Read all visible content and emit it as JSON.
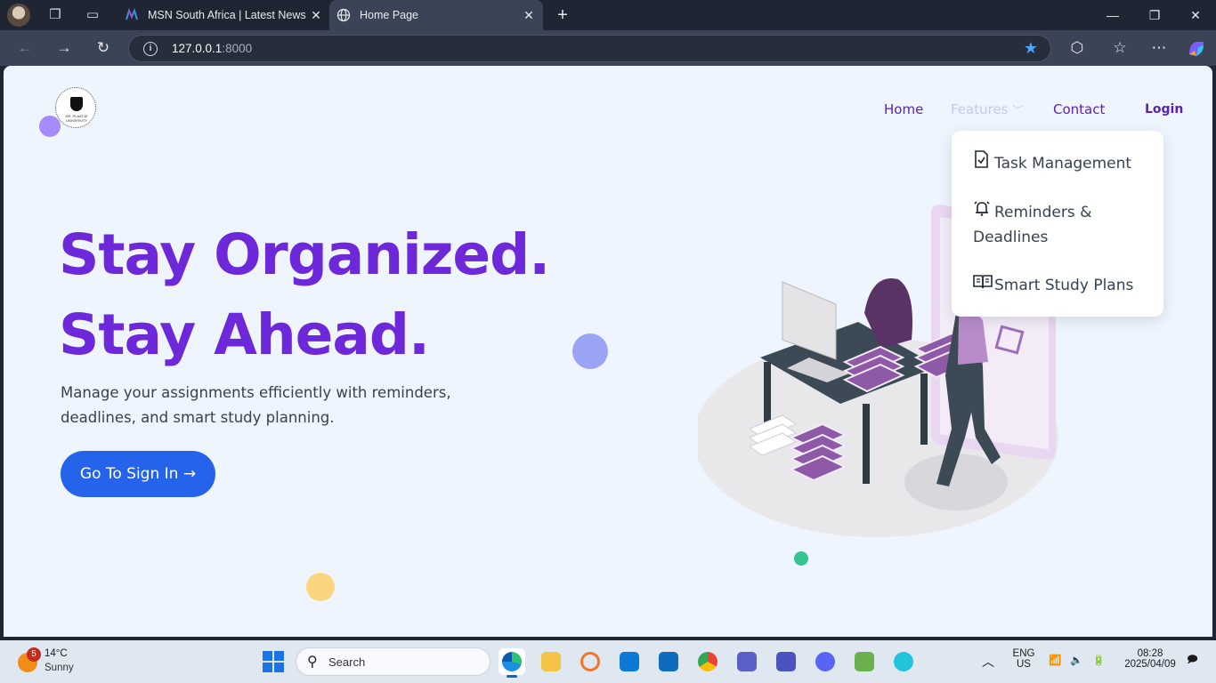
{
  "browser": {
    "tabs": [
      {
        "title": "MSN South Africa | Latest News, F",
        "icon": "msn-icon",
        "active": false
      },
      {
        "title": "Home Page",
        "icon": "globe-icon",
        "active": true
      }
    ],
    "url_host": "127.0.0.1",
    "url_port": ":8000"
  },
  "site": {
    "logo_caption": "DR. PLAATJE UNIVERSITY",
    "nav": {
      "home": "Home",
      "features": "Features",
      "contact": "Contact",
      "login": "Login"
    },
    "features_menu": [
      {
        "label": "Task Management",
        "icon": "clipboard-check-icon"
      },
      {
        "label": "Reminders & Deadlines",
        "icon": "alarm-bell-icon"
      },
      {
        "label": "Smart Study Plans",
        "icon": "open-book-icon"
      }
    ],
    "hero": {
      "line1": "Stay Organized.",
      "line2": "Stay Ahead.",
      "subtitle": "Manage your assignments efficiently with reminders, deadlines, and smart study planning.",
      "cta": "Go To Sign In →"
    },
    "colors": {
      "accent_purple": "#6d28d9",
      "cta_blue": "#2563eb",
      "page_bg": "#eff5fe"
    }
  },
  "taskbar": {
    "weather_badge": "5",
    "temperature": "14°C",
    "condition": "Sunny",
    "search_placeholder": "Search",
    "lang": "ENG",
    "region": "US",
    "time": "08:28",
    "date": "2025/04/09"
  }
}
